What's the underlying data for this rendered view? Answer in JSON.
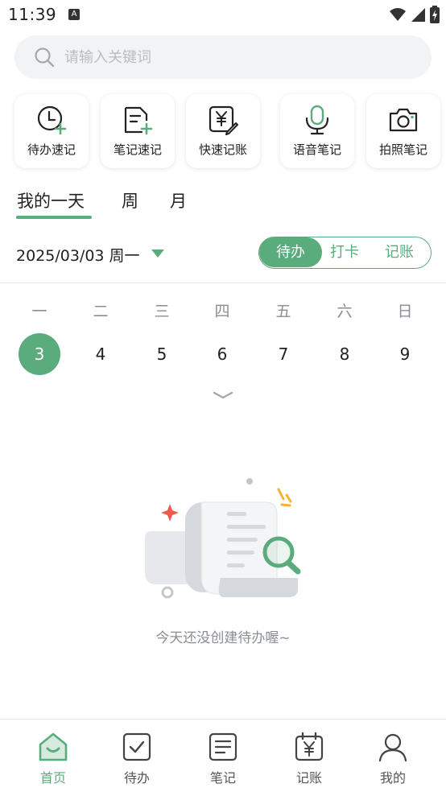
{
  "status_bar": {
    "time": "11:39",
    "notification_glyph": "A",
    "icons": [
      "wifi-icon",
      "signal-icon",
      "battery-icon"
    ]
  },
  "search": {
    "placeholder": "请输入关键词",
    "value": ""
  },
  "shortcuts": [
    {
      "label": "待办速记",
      "icon": "clock-add-icon"
    },
    {
      "label": "笔记速记",
      "icon": "note-add-icon"
    },
    {
      "label": "快速记账",
      "icon": "yen-edit-icon"
    },
    {
      "label": "语音笔记",
      "icon": "microphone-icon"
    },
    {
      "label": "拍照笔记",
      "icon": "camera-icon"
    }
  ],
  "day_tabs": [
    {
      "label": "我的一天",
      "active": true
    },
    {
      "label": "周",
      "active": false
    },
    {
      "label": "月",
      "active": false
    }
  ],
  "date_selector": {
    "value": "2025/03/03 周一"
  },
  "segment": {
    "options": [
      "待办",
      "打卡",
      "记账"
    ],
    "selected": "待办"
  },
  "week": {
    "headers": [
      "一",
      "二",
      "三",
      "四",
      "五",
      "六",
      "日"
    ],
    "days": [
      "3",
      "4",
      "5",
      "6",
      "7",
      "8",
      "9"
    ],
    "selected_day": "3"
  },
  "empty_state": {
    "message": "今天还没创建待办喔~"
  },
  "bottom_nav": [
    {
      "label": "首页",
      "icon": "home-icon",
      "active": true
    },
    {
      "label": "待办",
      "icon": "checkbox-icon",
      "active": false
    },
    {
      "label": "笔记",
      "icon": "note-icon",
      "active": false
    },
    {
      "label": "记账",
      "icon": "calendar-yen-icon",
      "active": false
    },
    {
      "label": "我的",
      "icon": "user-icon",
      "active": false
    }
  ],
  "colors": {
    "accent": "#5aac7c",
    "text": "#222222",
    "muted": "#8a8d93",
    "search_bg": "#f2f3f5"
  }
}
